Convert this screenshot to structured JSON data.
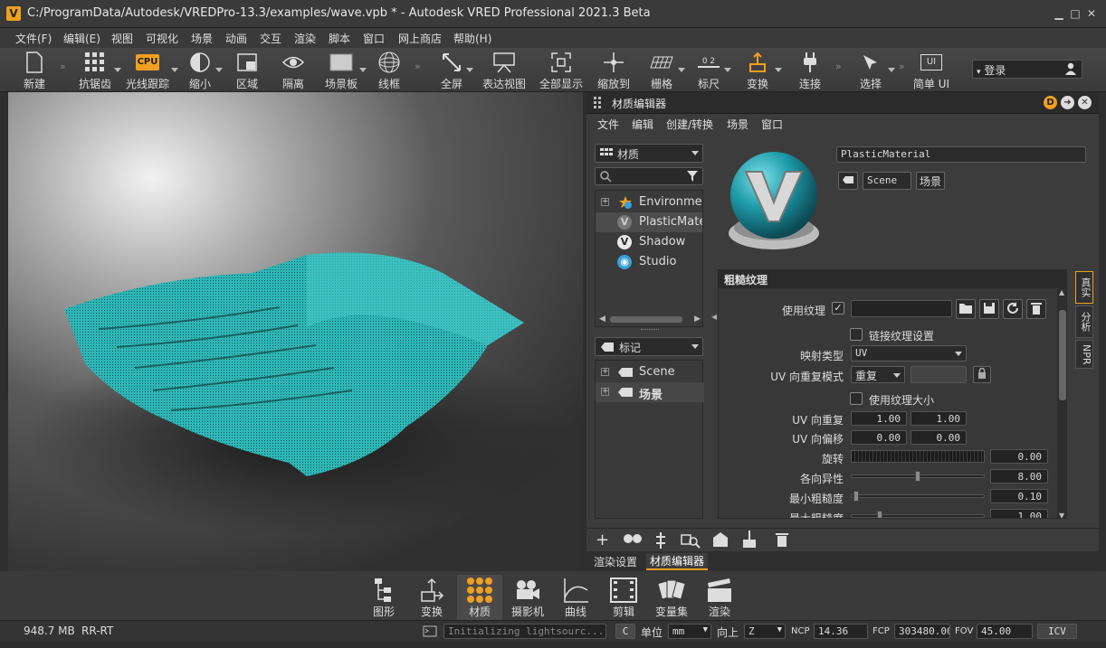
{
  "window": {
    "title": "C:/ProgramData/Autodesk/VREDPro-13.3/examples/wave.vpb * - Autodesk VRED Professional 2021.3 Beta",
    "logo": "V"
  },
  "menubar": [
    "文件(F)",
    "编辑(E)",
    "视图",
    "可视化",
    "场景",
    "动画",
    "交互",
    "渲染",
    "脚本",
    "窗口",
    "网上商店",
    "帮助(H)"
  ],
  "toolbar": {
    "new": "新建",
    "antialias": "抗锯齿",
    "raytrace": "光线跟踪",
    "raytrace_badge": "CPU",
    "minimize": "缩小",
    "region": "区域",
    "isolate": "隔离",
    "scene_plate": "场景板",
    "wireframe": "线框",
    "fullscreen": "全屏",
    "presenter": "表达视图",
    "show_all": "全部显示",
    "zoom_to": "缩放到",
    "grid": "栅格",
    "ruler": "标尺",
    "ruler_badge": "0 2",
    "transform": "变换",
    "connect": "连接",
    "select": "选择",
    "simple_ui": "简单 UI",
    "simple_ui_badge": "UI",
    "login": "登录"
  },
  "material_editor": {
    "title": "材质编辑器",
    "menu": [
      "文件",
      "编辑",
      "创建/转换",
      "场景",
      "窗口"
    ],
    "materials_combo": "材质",
    "materials": [
      {
        "name": "Environment",
        "icon": "environment-icon",
        "expandable": true
      },
      {
        "name": "PlasticMaterial",
        "icon": "vred-material-icon",
        "selected": true
      },
      {
        "name": "Shadow",
        "icon": "vred-material-icon"
      },
      {
        "name": "Studio",
        "icon": "studio-icon"
      }
    ],
    "tags_combo": "标记",
    "tags": [
      {
        "name": "Scene",
        "bold": false
      },
      {
        "name": "场景",
        "bold": true
      }
    ],
    "material_name": "PlasticMaterial",
    "tag_chips": [
      "Scene",
      "场景"
    ],
    "section_title": "粗糙纹理",
    "props": {
      "use_texture": "使用纹理",
      "link_texture": "链接纹理设置",
      "mapping_type_label": "映射类型",
      "mapping_type_value": "UV",
      "uv_repeat_mode_label": "UV 向重复模式",
      "uv_repeat_mode_value": "重复",
      "use_texture_size": "使用纹理大小",
      "uv_repeat_label": "UV 向重复",
      "uv_repeat_u": "1.00",
      "uv_repeat_v": "1.00",
      "uv_offset_label": "UV 向偏移",
      "uv_offset_u": "0.00",
      "uv_offset_v": "0.00",
      "rotation_label": "旋转",
      "rotation_value": "0.00",
      "anisotropy_label": "各向异性",
      "anisotropy_value": "8.00",
      "min_roughness_label": "最小粗糙度",
      "min_roughness_value": "0.10",
      "max_roughness_label": "最大粗糙度",
      "max_roughness_value": "1.00"
    },
    "side_tabs": [
      "真实",
      "分析",
      "NPR"
    ],
    "bottom_tabs": [
      "渲染设置",
      "材质编辑器"
    ]
  },
  "bottom_toolbar": [
    "图形",
    "变换",
    "材质",
    "摄影机",
    "曲线",
    "剪辑",
    "变量集",
    "渲染"
  ],
  "statusbar": {
    "memory": "948.7 MB",
    "mode": "RR-RT",
    "message": "Initializing lightsourc...",
    "c_button": "C",
    "unit_label": "单位",
    "unit_value": "mm",
    "up_label": "向上",
    "up_value": "Z",
    "ncp_label": "NCP",
    "ncp_value": "14.36",
    "fcp_label": "FCP",
    "fcp_value": "303480.00",
    "fov_label": "FOV",
    "fov_value": "45.00",
    "icv": "ICV"
  }
}
